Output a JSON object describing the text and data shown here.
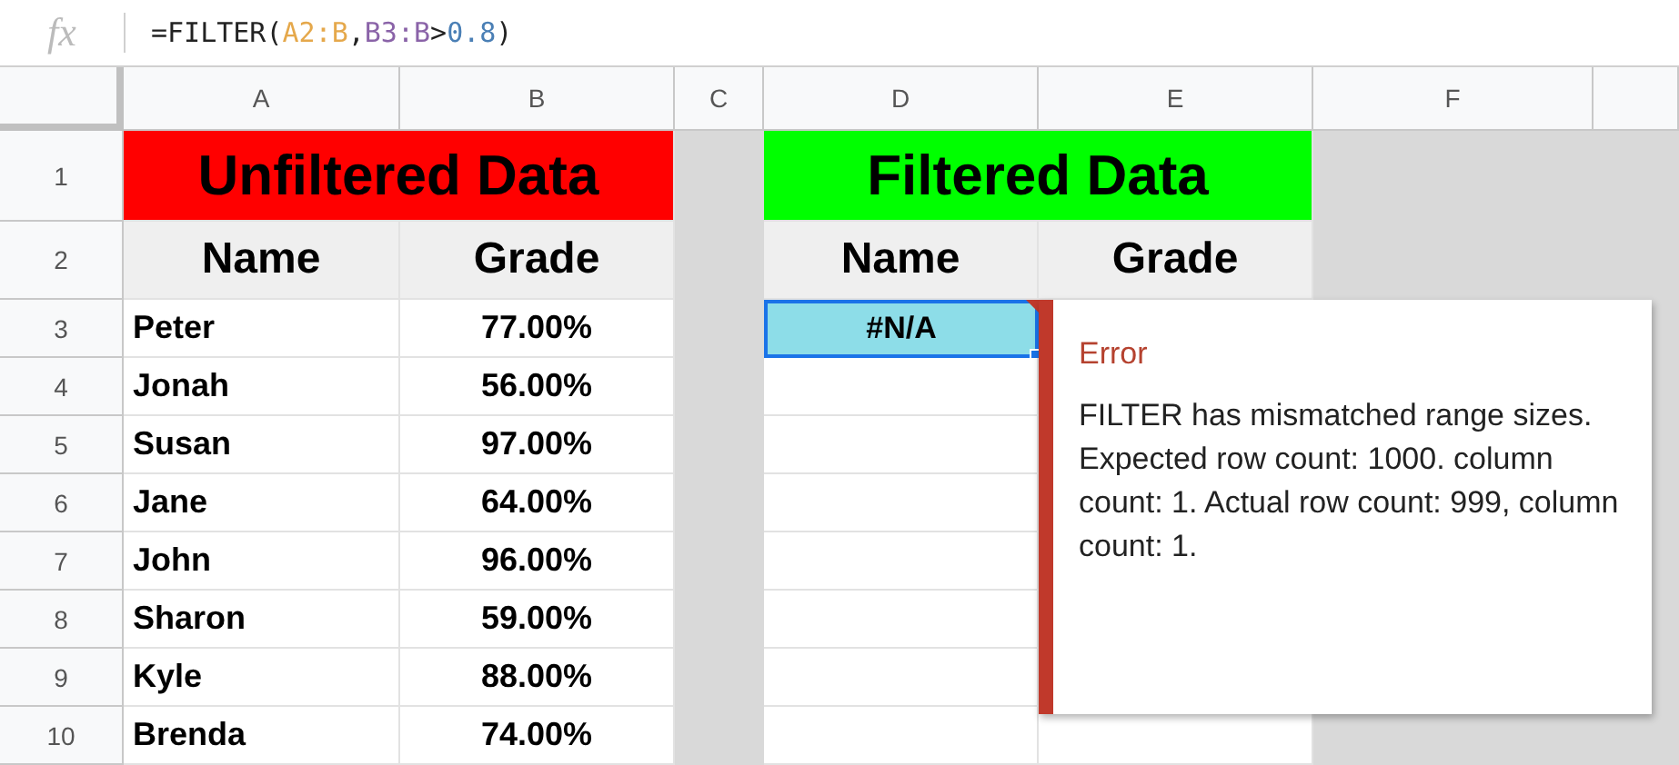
{
  "formula_bar": {
    "icon_text": "fx",
    "tokens": [
      {
        "text": "=FILTER(",
        "color": "#222222"
      },
      {
        "text": "A2:B",
        "color": "#e5a84b"
      },
      {
        "text": ",",
        "color": "#222222"
      },
      {
        "text": "B3:B",
        "color": "#8a63a8"
      },
      {
        "text": ">",
        "color": "#222222"
      },
      {
        "text": "0.8",
        "color": "#4a7fb5"
      },
      {
        "text": ")",
        "color": "#222222"
      }
    ]
  },
  "column_headers": [
    "A",
    "B",
    "C",
    "D",
    "E",
    "F"
  ],
  "row_headers": [
    "1",
    "2",
    "3",
    "4",
    "5",
    "6",
    "7",
    "8",
    "9",
    "10"
  ],
  "left_table": {
    "title": "Unfiltered Data",
    "color": "#ff0000",
    "headers": [
      "Name",
      "Grade"
    ],
    "rows": [
      [
        "Peter",
        "77.00%"
      ],
      [
        "Jonah",
        "56.00%"
      ],
      [
        "Susan",
        "97.00%"
      ],
      [
        "Jane",
        "64.00%"
      ],
      [
        "John",
        "96.00%"
      ],
      [
        "Sharon",
        "59.00%"
      ],
      [
        "Kyle",
        "88.00%"
      ],
      [
        "Brenda",
        "74.00%"
      ]
    ]
  },
  "right_table": {
    "title": "Filtered Data",
    "color": "#00ff00",
    "headers": [
      "Name",
      "Grade"
    ],
    "cells": [
      {
        "text": "#N/A",
        "selected": true,
        "error": true
      }
    ]
  },
  "error_popup": {
    "title": "Error",
    "message": "FILTER has mismatched range sizes. Expected row count: 1000. column count: 1. Actual row count: 999, column count: 1."
  }
}
